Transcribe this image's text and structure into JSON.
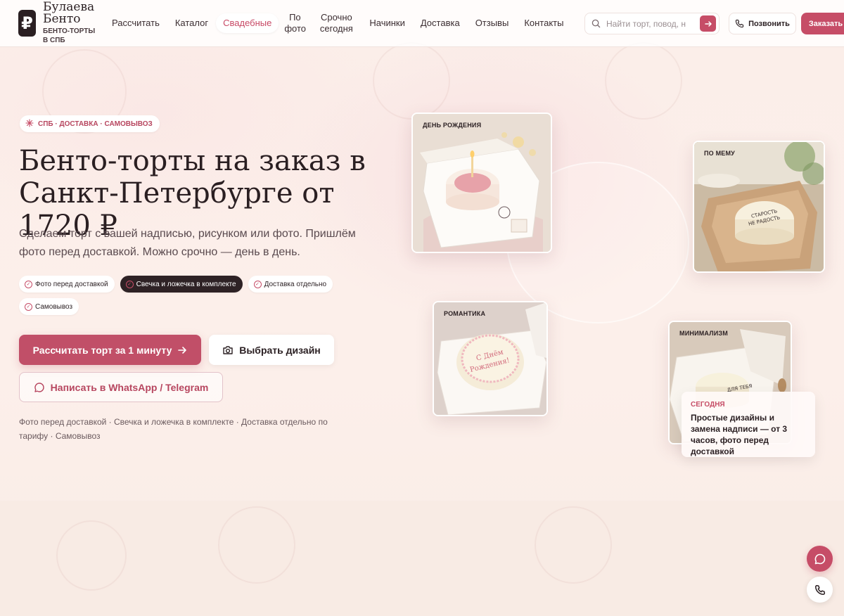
{
  "brand": {
    "logo_glyph": "₽",
    "name_line1": "Булаева",
    "name_line2": "Бенто",
    "subtitle": "БЕНТО-ТОРТЫ В СПБ"
  },
  "nav": {
    "items": [
      {
        "label": "Рассчитать"
      },
      {
        "label": "Каталог"
      },
      {
        "label": "Свадебные",
        "active": true
      },
      {
        "label": "По фото"
      },
      {
        "label": "Срочно сегодня"
      },
      {
        "label": "Начинки"
      },
      {
        "label": "Доставка"
      },
      {
        "label": "Отзывы"
      },
      {
        "label": "Контакты"
      }
    ]
  },
  "search": {
    "placeholder": "Найти торт, повод, н",
    "go_icon": "arrow-right-icon"
  },
  "header_actions": {
    "call_label": "Позвонить",
    "order_label": "Заказать"
  },
  "hero": {
    "tag": "СПБ · ДОСТАВКА · САМОВЫВОЗ",
    "title_line1": "Бенто-торты на заказ в",
    "title_line2": "Санкт-Петербурге от 1720 ₽",
    "subtitle": "Сделаем торт с вашей надписью, рисунком или фото. Пришлём фото перед доставкой. Можно срочно — день в день.",
    "chips": [
      {
        "label": "Фото перед доставкой"
      },
      {
        "label": "Свечка и ложечка в комплекте",
        "selected": true
      },
      {
        "label": "Доставка отдельно"
      },
      {
        "label": "Самовывоз"
      }
    ],
    "cta_calc": "Рассчитать торт за 1 минуту",
    "cta_design": "Выбрать дизайн",
    "cta_message": "Написать в WhatsApp / Telegram",
    "note": "Фото перед доставкой · Свечка и ложечка в комплекте · Доставка отдельно по тарифу · Самовывоз"
  },
  "cards": [
    {
      "label": "ДЕНЬ РОЖДЕНИЯ"
    },
    {
      "label": "ПО МЕМУ",
      "cake_text": "СТАРОСТЬ НЕ РАДОСТЬ"
    },
    {
      "label": "РОМАНТИКА",
      "cake_text": "С Днём Рождения!"
    },
    {
      "label": "МИНИМАЛИЗМ",
      "cake_text": "ДЛЯ ТЕБЯ"
    }
  ],
  "info_card": {
    "kicker": "СЕГОДНЯ",
    "text": "Простые дизайны и замена надписи — от 3 часов, фото перед доставкой"
  },
  "colors": {
    "accent": "#c64d67",
    "dark": "#2a1f22",
    "background": "#fbf0ec"
  }
}
